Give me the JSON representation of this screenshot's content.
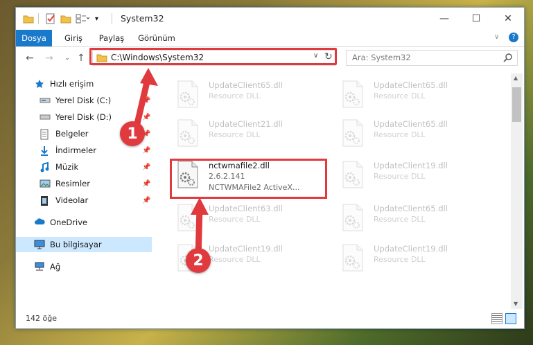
{
  "window": {
    "title": "System32"
  },
  "ribbon": {
    "tabs": [
      "Dosya",
      "Giriş",
      "Paylaş",
      "Görünüm"
    ]
  },
  "address": {
    "path": "C:\\Windows\\System32"
  },
  "search": {
    "placeholder": "Ara: System32"
  },
  "nav": {
    "quick_access": "Hızlı erişim",
    "items": [
      {
        "label": "Yerel Disk (C:)",
        "pinned": true
      },
      {
        "label": "Yerel Disk (D:)",
        "pinned": true
      },
      {
        "label": "Belgeler",
        "pinned": true
      },
      {
        "label": "İndirmeler",
        "pinned": true
      },
      {
        "label": "Müzik",
        "pinned": true
      },
      {
        "label": "Resimler",
        "pinned": true
      },
      {
        "label": "Videolar",
        "pinned": true
      }
    ],
    "onedrive": "OneDrive",
    "this_pc": "Bu bilgisayar",
    "network": "Ağ"
  },
  "files": [
    {
      "name": "UpdateClient65.dll",
      "desc": "Resource DLL",
      "faded": true
    },
    {
      "name": "UpdateClient65.dll",
      "desc": "Resource DLL",
      "faded": true
    },
    {
      "name": "UpdateClient21.dll",
      "desc": "Resource DLL",
      "faded": true
    },
    {
      "name": "UpdateClient65.dll",
      "desc": "Resource DLL",
      "faded": true
    },
    {
      "name": "nctwmafile2.dll",
      "version": "2.6.2.141",
      "desc": "NCTWMAFile2 ActiveX...",
      "faded": false
    },
    {
      "name": "UpdateClient19.dll",
      "desc": "Resource DLL",
      "faded": true
    },
    {
      "name": "UpdateClient63.dll",
      "desc": "Resource DLL",
      "faded": true
    },
    {
      "name": "UpdateClient65.dll",
      "desc": "Resource DLL",
      "faded": true
    },
    {
      "name": "UpdateClient19.dll",
      "desc": "Resource DLL",
      "faded": true
    },
    {
      "name": "UpdateClient19.dll",
      "desc": "Resource DLL",
      "faded": true
    }
  ],
  "status": {
    "count": "142 öğe"
  },
  "annotations": {
    "step1": "1",
    "step2": "2"
  },
  "colors": {
    "accent": "#1979ca",
    "highlight": "#e0393e",
    "selection": "#cce8ff"
  }
}
